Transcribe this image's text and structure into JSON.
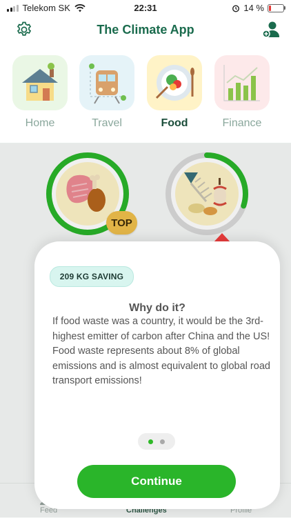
{
  "status_bar": {
    "carrier": "Telekom SK",
    "time": "22:31",
    "battery": "14 %",
    "battery_fraction": 0.14
  },
  "header": {
    "title": "The Climate App",
    "settings_icon": "gear-icon",
    "add_user_icon": "add-user-icon"
  },
  "categories": [
    {
      "label": "Home",
      "icon": "house-icon",
      "active": false
    },
    {
      "label": "Travel",
      "icon": "train-icon",
      "active": false
    },
    {
      "label": "Food",
      "icon": "plate-icon",
      "active": true
    },
    {
      "label": "Finance",
      "icon": "bar-chart-icon",
      "active": false
    }
  ],
  "challenges": [
    {
      "icon": "meat-icon",
      "badge": "TOP",
      "progress": 1.0
    },
    {
      "icon": "food-waste-icon",
      "progress": 0.3
    }
  ],
  "card": {
    "saving": "209 KG SAVING",
    "heading": "Why do it?",
    "body": "If food waste was a country, it would be the 3rd-highest emitter of carbon after China and the US! Food waste represents about 8% of global emissions and is almost equivalent to global road transport emissions!",
    "page_index": 1,
    "page_count": 2,
    "continue_label": "Continue"
  },
  "tabbar": {
    "items": [
      {
        "label": "Feed"
      },
      {
        "label": "Challenges"
      },
      {
        "label": "Profile"
      }
    ],
    "active": "Challenges"
  },
  "colors": {
    "brand": "#1a6b4d",
    "accent": "#2ab52a",
    "badge": "#f0c04c",
    "pointer": "#e83b3b"
  }
}
